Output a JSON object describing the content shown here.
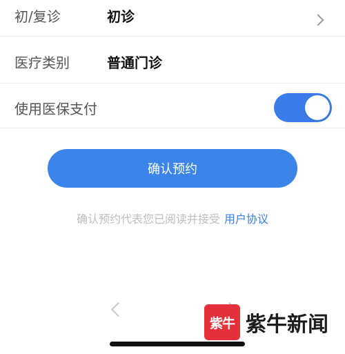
{
  "form": {
    "visit_type": {
      "label": "初/复诊",
      "value": "初诊"
    },
    "medical_category": {
      "label": "医疗类别",
      "value": "普通门诊"
    },
    "use_insurance": {
      "label": "使用医保支付",
      "enabled": true
    }
  },
  "confirm_button": {
    "label": "确认预约"
  },
  "agreement": {
    "text": "确认预约代表您已阅读并接受",
    "link": "用户协议"
  },
  "watermark": {
    "logo_text": "紫牛",
    "brand": "紫牛新闻"
  },
  "colors": {
    "accent": "#3b84ea",
    "link": "#3b7de8",
    "watermark": "#e3303a"
  }
}
